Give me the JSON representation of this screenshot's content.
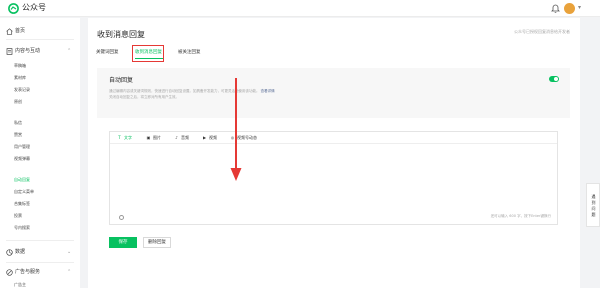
{
  "header": {
    "brand": "公众号",
    "brand_color": "#07c160",
    "icons": [
      "wechat-mp-logo-icon",
      "bell-icon",
      "avatar",
      "chevron-down-icon"
    ]
  },
  "sidebar": {
    "home": {
      "label": "首页",
      "icon": "home-icon"
    },
    "content": {
      "label": "内容与互动",
      "icon": "document-icon",
      "items": [
        "草稿箱",
        "素材库",
        "发表记录",
        "原创",
        "私信",
        "赞赏",
        "用户管理",
        "视频弹幕",
        "自动回复",
        "自定义菜单",
        "合集标签",
        "投票",
        "号内搜索"
      ],
      "active_index": 8
    },
    "data": {
      "label": "数据",
      "icon": "chart-icon"
    },
    "ads": {
      "label": "广告与服务",
      "icon": "ad-icon",
      "sub_first": "广告主"
    }
  },
  "main": {
    "title": "收到消息回复",
    "top_right_note": "公众号已授权回复消息给开发者",
    "tabs": [
      {
        "label": "关键词回复"
      },
      {
        "label": "收到消息回复",
        "active": true
      },
      {
        "label": "被关注回复"
      }
    ],
    "auto_reply": {
      "title": "自动回复",
      "desc": "通过编辑内容或关键词规则，快速进行自动回复设置。如具备开发能力，可更灵活地使用该功能。",
      "link": "查看详情",
      "desc2": "关闭自动回复之后，将立即对所有用户生效。",
      "enabled": true
    },
    "editor": {
      "tools": [
        {
          "label": "文字",
          "icon": "text-icon",
          "glyph": "T",
          "active": true
        },
        {
          "label": "图片",
          "icon": "image-icon",
          "glyph": "▣"
        },
        {
          "label": "音频",
          "icon": "audio-icon",
          "glyph": "♪"
        },
        {
          "label": "视频",
          "icon": "video-icon",
          "glyph": "▶"
        },
        {
          "label": "视频号动态",
          "icon": "channels-icon",
          "glyph": "◎"
        }
      ],
      "counter": "还可以输入 600 字，按下Enter键换行"
    },
    "buttons": {
      "save": "保存",
      "delete": "删除回复"
    }
  },
  "feedback": {
    "label": "遇到问题"
  },
  "annotation": {
    "highlight_color": "#e53935"
  }
}
